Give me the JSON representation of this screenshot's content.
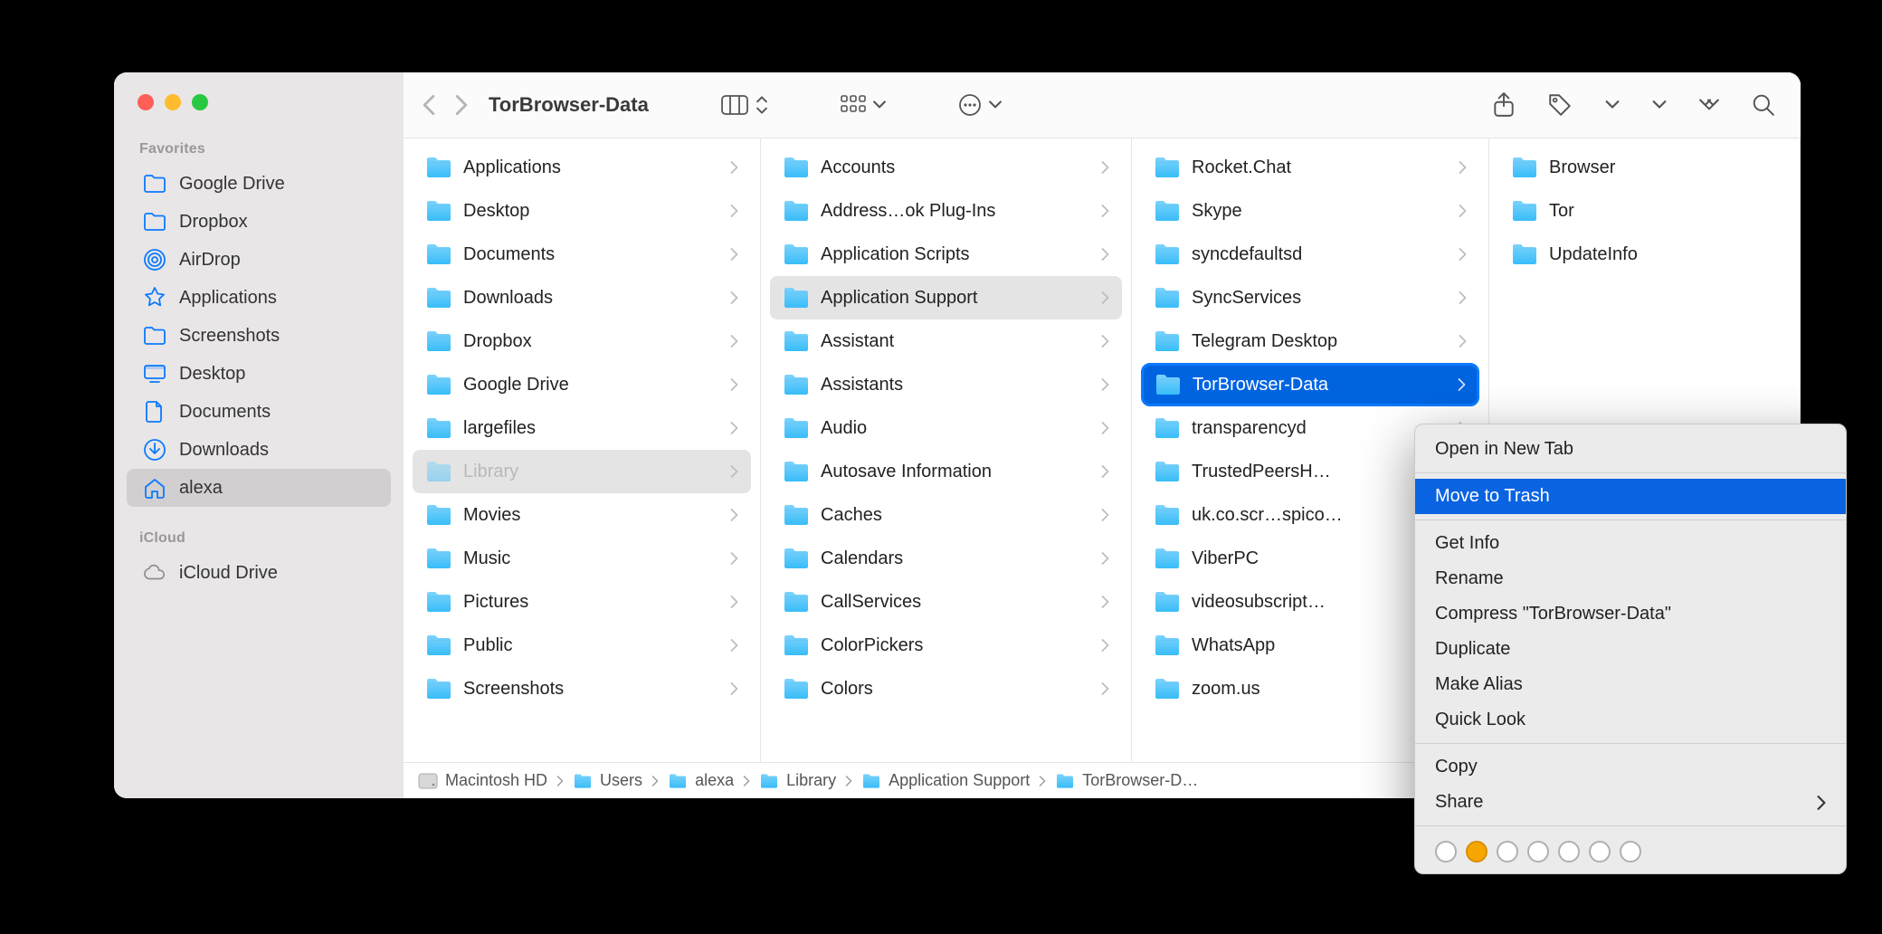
{
  "window_title": "TorBrowser-Data",
  "sidebar": {
    "favorites_label": "Favorites",
    "icloud_label": "iCloud",
    "favorites": [
      {
        "icon": "folder",
        "label": "Google Drive"
      },
      {
        "icon": "folder",
        "label": "Dropbox"
      },
      {
        "icon": "airdrop",
        "label": "AirDrop"
      },
      {
        "icon": "apps",
        "label": "Applications"
      },
      {
        "icon": "folder",
        "label": "Screenshots"
      },
      {
        "icon": "desktop",
        "label": "Desktop"
      },
      {
        "icon": "doc",
        "label": "Documents"
      },
      {
        "icon": "download",
        "label": "Downloads"
      },
      {
        "icon": "home",
        "label": "alexa",
        "selected": true
      }
    ],
    "icloud": [
      {
        "icon": "cloud",
        "label": "iCloud Drive"
      }
    ]
  },
  "columns": [
    [
      {
        "label": "Applications",
        "chev": true
      },
      {
        "label": "Desktop",
        "chev": true
      },
      {
        "label": "Documents",
        "chev": true
      },
      {
        "label": "Downloads",
        "chev": true
      },
      {
        "label": "Dropbox",
        "chev": true
      },
      {
        "label": "Google Drive",
        "chev": true,
        "gd": true
      },
      {
        "label": "largefiles",
        "chev": true
      },
      {
        "label": "Library",
        "chev": true,
        "dim": true,
        "sel": "gray"
      },
      {
        "label": "Movies",
        "chev": true
      },
      {
        "label": "Music",
        "chev": true
      },
      {
        "label": "Pictures",
        "chev": true
      },
      {
        "label": "Public",
        "chev": true
      },
      {
        "label": "Screenshots",
        "chev": true
      }
    ],
    [
      {
        "label": "Accounts",
        "chev": true
      },
      {
        "label": "Address…ok Plug-Ins",
        "chev": true
      },
      {
        "label": "Application Scripts",
        "chev": true
      },
      {
        "label": "Application Support",
        "chev": true,
        "sel": "gray"
      },
      {
        "label": "Assistant",
        "chev": true
      },
      {
        "label": "Assistants",
        "chev": true
      },
      {
        "label": "Audio",
        "chev": true
      },
      {
        "label": "Autosave Information",
        "chev": true
      },
      {
        "label": "Caches",
        "chev": true
      },
      {
        "label": "Calendars",
        "chev": true
      },
      {
        "label": "CallServices",
        "chev": true
      },
      {
        "label": "ColorPickers",
        "chev": true
      },
      {
        "label": "Colors",
        "chev": true
      }
    ],
    [
      {
        "label": "Rocket.Chat",
        "chev": true
      },
      {
        "label": "Skype",
        "chev": true
      },
      {
        "label": "syncdefaultsd",
        "chev": true
      },
      {
        "label": "SyncServices",
        "chev": true
      },
      {
        "label": "Telegram Desktop",
        "chev": true
      },
      {
        "label": "TorBrowser-Data",
        "chev": true,
        "sel": "blue"
      },
      {
        "label": "transparencyd",
        "chev": true
      },
      {
        "label": "TrustedPeersH…",
        "chev": true
      },
      {
        "label": "uk.co.scr…spico…",
        "chev": true
      },
      {
        "label": "ViberPC",
        "chev": true
      },
      {
        "label": "videosubscript…",
        "chev": true
      },
      {
        "label": "WhatsApp",
        "chev": true
      },
      {
        "label": "zoom.us",
        "chev": true
      }
    ],
    [
      {
        "label": "Browser",
        "chev": false
      },
      {
        "label": "Tor",
        "chev": false
      },
      {
        "label": "UpdateInfo",
        "chev": false
      }
    ]
  ],
  "pathbar": [
    "Macintosh HD",
    "Users",
    "alexa",
    "Library",
    "Application Support",
    "TorBrowser-D…"
  ],
  "context_menu": {
    "items": [
      {
        "label": "Open in New Tab"
      },
      {
        "sep": true
      },
      {
        "label": "Move to Trash",
        "hl": true
      },
      {
        "sep": true
      },
      {
        "label": "Get Info"
      },
      {
        "label": "Rename"
      },
      {
        "label": "Compress \"TorBrowser-Data\""
      },
      {
        "label": "Duplicate"
      },
      {
        "label": "Make Alias"
      },
      {
        "label": "Quick Look"
      },
      {
        "sep": true
      },
      {
        "label": "Copy"
      },
      {
        "label": "Share",
        "submenu": true
      },
      {
        "sep": true
      }
    ]
  }
}
